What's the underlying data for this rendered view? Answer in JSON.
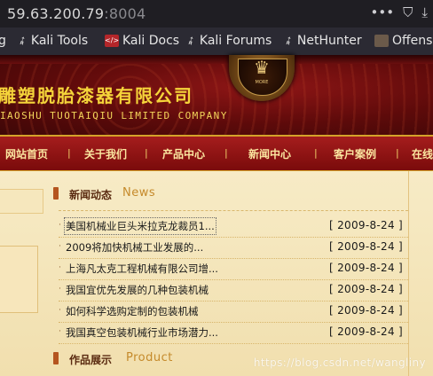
{
  "browser": {
    "url_host": "59.63.200.79",
    "url_port": ":8004",
    "icons": [
      "more-icon",
      "pocket-icon",
      "download-icon"
    ],
    "bookmarks": [
      {
        "label": "g",
        "icon": "none"
      },
      {
        "label": "Kali Tools",
        "icon": "kali-dragon-icon"
      },
      {
        "label": "Kali Docs",
        "icon": "kali-docs-icon"
      },
      {
        "label": "Kali Forums",
        "icon": "kali-dragon-icon"
      },
      {
        "label": "NetHunter",
        "icon": "kali-dragon-icon"
      },
      {
        "label": "Offens",
        "icon": "offensive-security-icon"
      }
    ]
  },
  "site": {
    "company_cn": "雕塑脱胎漆器有限公司",
    "company_en": "IAOSHU  TUOTAIQIU  LIMITED COMPANY",
    "emblem_glyph": "♛",
    "emblem_text": "MORE"
  },
  "nav": {
    "items": [
      "网站首页",
      "关于我们",
      "产品中心",
      "新闻中心",
      "客户案例",
      "在线"
    ],
    "separator": "|"
  },
  "news": {
    "title_cn": "新闻动态",
    "title_en": "News",
    "items": [
      {
        "title": "美国机械业巨头米拉克龙裁员1...",
        "date": "[ 2009-8-24 ]"
      },
      {
        "title": "2009将加快机械工业发展的...",
        "date": "[ 2009-8-24 ]"
      },
      {
        "title": "上海凡太克工程机械有限公司增...",
        "date": "[ 2009-8-24 ]"
      },
      {
        "title": "我国宜优先发展的几种包装机械",
        "date": "[ 2009-8-24 ]"
      },
      {
        "title": "如何科学选购定制的包装机械",
        "date": "[ 2009-8-24 ]"
      },
      {
        "title": "我国真空包装机械行业市场潜力...",
        "date": "[ 2009-8-24 ]"
      }
    ]
  },
  "products": {
    "title_cn": "作品展示",
    "title_en": "Product"
  },
  "watermark": "https://blog.csdn.net/wangliny"
}
